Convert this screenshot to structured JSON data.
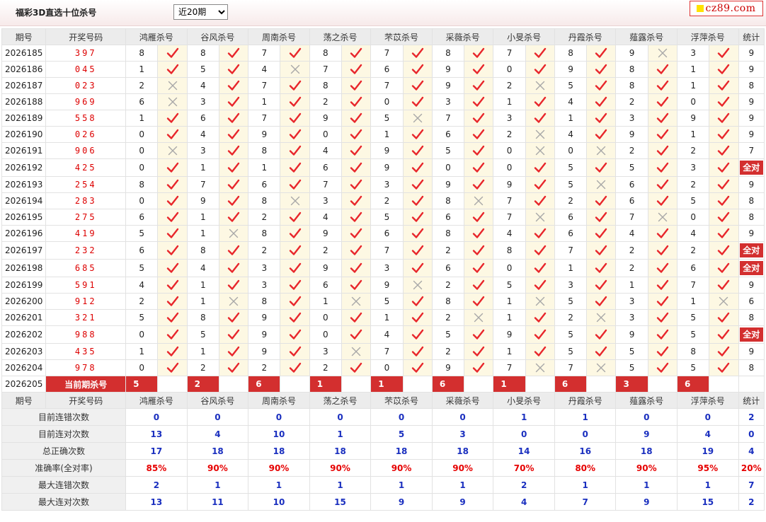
{
  "header": {
    "title": "福彩3D直选十位杀号",
    "range_options": [
      "近20期"
    ],
    "range_selected": "近20期",
    "logo_text": "cz89.com"
  },
  "columns": {
    "issue": "期号",
    "winning": "开奖号码",
    "stat": "统计",
    "experts": [
      "鸿雁杀号",
      "谷风杀号",
      "周南杀号",
      "荡之杀号",
      "芣苡杀号",
      "采薇杀号",
      "小旻杀号",
      "丹霞杀号",
      "薤露杀号",
      "浮萍杀号"
    ]
  },
  "rows": [
    {
      "issue": "2026185",
      "winning": "397",
      "kills": [
        {
          "n": "8",
          "ok": true
        },
        {
          "n": "8",
          "ok": true
        },
        {
          "n": "7",
          "ok": true
        },
        {
          "n": "8",
          "ok": true
        },
        {
          "n": "7",
          "ok": true
        },
        {
          "n": "8",
          "ok": true
        },
        {
          "n": "7",
          "ok": true
        },
        {
          "n": "8",
          "ok": true
        },
        {
          "n": "9",
          "ok": false
        },
        {
          "n": "3",
          "ok": true
        }
      ],
      "stat": "9"
    },
    {
      "issue": "2026186",
      "winning": "045",
      "kills": [
        {
          "n": "1",
          "ok": true
        },
        {
          "n": "5",
          "ok": true
        },
        {
          "n": "4",
          "ok": false
        },
        {
          "n": "7",
          "ok": true
        },
        {
          "n": "6",
          "ok": true
        },
        {
          "n": "9",
          "ok": true
        },
        {
          "n": "0",
          "ok": true
        },
        {
          "n": "9",
          "ok": true
        },
        {
          "n": "8",
          "ok": true
        },
        {
          "n": "1",
          "ok": true
        }
      ],
      "stat": "9"
    },
    {
      "issue": "2026187",
      "winning": "023",
      "kills": [
        {
          "n": "2",
          "ok": false
        },
        {
          "n": "4",
          "ok": true
        },
        {
          "n": "7",
          "ok": true
        },
        {
          "n": "8",
          "ok": true
        },
        {
          "n": "7",
          "ok": true
        },
        {
          "n": "9",
          "ok": true
        },
        {
          "n": "2",
          "ok": false
        },
        {
          "n": "5",
          "ok": true
        },
        {
          "n": "8",
          "ok": true
        },
        {
          "n": "1",
          "ok": true
        }
      ],
      "stat": "8"
    },
    {
      "issue": "2026188",
      "winning": "969",
      "kills": [
        {
          "n": "6",
          "ok": false
        },
        {
          "n": "3",
          "ok": true
        },
        {
          "n": "1",
          "ok": true
        },
        {
          "n": "2",
          "ok": true
        },
        {
          "n": "0",
          "ok": true
        },
        {
          "n": "3",
          "ok": true
        },
        {
          "n": "1",
          "ok": true
        },
        {
          "n": "4",
          "ok": true
        },
        {
          "n": "2",
          "ok": true
        },
        {
          "n": "0",
          "ok": true
        }
      ],
      "stat": "9"
    },
    {
      "issue": "2026189",
      "winning": "558",
      "kills": [
        {
          "n": "1",
          "ok": true
        },
        {
          "n": "6",
          "ok": true
        },
        {
          "n": "7",
          "ok": true
        },
        {
          "n": "9",
          "ok": true
        },
        {
          "n": "5",
          "ok": false
        },
        {
          "n": "7",
          "ok": true
        },
        {
          "n": "3",
          "ok": true
        },
        {
          "n": "1",
          "ok": true
        },
        {
          "n": "3",
          "ok": true
        },
        {
          "n": "9",
          "ok": true
        }
      ],
      "stat": "9"
    },
    {
      "issue": "2026190",
      "winning": "026",
      "kills": [
        {
          "n": "0",
          "ok": true
        },
        {
          "n": "4",
          "ok": true
        },
        {
          "n": "9",
          "ok": true
        },
        {
          "n": "0",
          "ok": true
        },
        {
          "n": "1",
          "ok": true
        },
        {
          "n": "6",
          "ok": true
        },
        {
          "n": "2",
          "ok": false
        },
        {
          "n": "4",
          "ok": true
        },
        {
          "n": "9",
          "ok": true
        },
        {
          "n": "1",
          "ok": true
        }
      ],
      "stat": "9"
    },
    {
      "issue": "2026191",
      "winning": "906",
      "kills": [
        {
          "n": "0",
          "ok": false
        },
        {
          "n": "3",
          "ok": true
        },
        {
          "n": "8",
          "ok": true
        },
        {
          "n": "4",
          "ok": true
        },
        {
          "n": "9",
          "ok": true
        },
        {
          "n": "5",
          "ok": true
        },
        {
          "n": "0",
          "ok": false
        },
        {
          "n": "0",
          "ok": false
        },
        {
          "n": "2",
          "ok": true
        },
        {
          "n": "2",
          "ok": true
        }
      ],
      "stat": "7"
    },
    {
      "issue": "2026192",
      "winning": "425",
      "kills": [
        {
          "n": "0",
          "ok": true
        },
        {
          "n": "1",
          "ok": true
        },
        {
          "n": "1",
          "ok": true
        },
        {
          "n": "6",
          "ok": true
        },
        {
          "n": "9",
          "ok": true
        },
        {
          "n": "0",
          "ok": true
        },
        {
          "n": "0",
          "ok": true
        },
        {
          "n": "5",
          "ok": true
        },
        {
          "n": "5",
          "ok": true
        },
        {
          "n": "3",
          "ok": true
        }
      ],
      "stat": "全对"
    },
    {
      "issue": "2026193",
      "winning": "254",
      "kills": [
        {
          "n": "8",
          "ok": true
        },
        {
          "n": "7",
          "ok": true
        },
        {
          "n": "6",
          "ok": true
        },
        {
          "n": "7",
          "ok": true
        },
        {
          "n": "3",
          "ok": true
        },
        {
          "n": "9",
          "ok": true
        },
        {
          "n": "9",
          "ok": true
        },
        {
          "n": "5",
          "ok": false
        },
        {
          "n": "6",
          "ok": true
        },
        {
          "n": "2",
          "ok": true
        }
      ],
      "stat": "9"
    },
    {
      "issue": "2026194",
      "winning": "283",
      "kills": [
        {
          "n": "0",
          "ok": true
        },
        {
          "n": "9",
          "ok": true
        },
        {
          "n": "8",
          "ok": false
        },
        {
          "n": "3",
          "ok": true
        },
        {
          "n": "2",
          "ok": true
        },
        {
          "n": "8",
          "ok": false
        },
        {
          "n": "7",
          "ok": true
        },
        {
          "n": "2",
          "ok": true
        },
        {
          "n": "6",
          "ok": true
        },
        {
          "n": "5",
          "ok": true
        }
      ],
      "stat": "8"
    },
    {
      "issue": "2026195",
      "winning": "275",
      "kills": [
        {
          "n": "6",
          "ok": true
        },
        {
          "n": "1",
          "ok": true
        },
        {
          "n": "2",
          "ok": true
        },
        {
          "n": "4",
          "ok": true
        },
        {
          "n": "5",
          "ok": true
        },
        {
          "n": "6",
          "ok": true
        },
        {
          "n": "7",
          "ok": false
        },
        {
          "n": "6",
          "ok": true
        },
        {
          "n": "7",
          "ok": false
        },
        {
          "n": "0",
          "ok": true
        }
      ],
      "stat": "8"
    },
    {
      "issue": "2026196",
      "winning": "419",
      "kills": [
        {
          "n": "5",
          "ok": true
        },
        {
          "n": "1",
          "ok": false
        },
        {
          "n": "8",
          "ok": true
        },
        {
          "n": "9",
          "ok": true
        },
        {
          "n": "6",
          "ok": true
        },
        {
          "n": "8",
          "ok": true
        },
        {
          "n": "4",
          "ok": true
        },
        {
          "n": "6",
          "ok": true
        },
        {
          "n": "4",
          "ok": true
        },
        {
          "n": "4",
          "ok": true
        }
      ],
      "stat": "9"
    },
    {
      "issue": "2026197",
      "winning": "232",
      "kills": [
        {
          "n": "6",
          "ok": true
        },
        {
          "n": "8",
          "ok": true
        },
        {
          "n": "2",
          "ok": true
        },
        {
          "n": "2",
          "ok": true
        },
        {
          "n": "7",
          "ok": true
        },
        {
          "n": "2",
          "ok": true
        },
        {
          "n": "8",
          "ok": true
        },
        {
          "n": "7",
          "ok": true
        },
        {
          "n": "2",
          "ok": true
        },
        {
          "n": "2",
          "ok": true
        }
      ],
      "stat": "全对"
    },
    {
      "issue": "2026198",
      "winning": "685",
      "kills": [
        {
          "n": "5",
          "ok": true
        },
        {
          "n": "4",
          "ok": true
        },
        {
          "n": "3",
          "ok": true
        },
        {
          "n": "9",
          "ok": true
        },
        {
          "n": "3",
          "ok": true
        },
        {
          "n": "6",
          "ok": true
        },
        {
          "n": "0",
          "ok": true
        },
        {
          "n": "1",
          "ok": true
        },
        {
          "n": "2",
          "ok": true
        },
        {
          "n": "6",
          "ok": true
        }
      ],
      "stat": "全对"
    },
    {
      "issue": "2026199",
      "winning": "591",
      "kills": [
        {
          "n": "4",
          "ok": true
        },
        {
          "n": "1",
          "ok": true
        },
        {
          "n": "3",
          "ok": true
        },
        {
          "n": "6",
          "ok": true
        },
        {
          "n": "9",
          "ok": false
        },
        {
          "n": "2",
          "ok": true
        },
        {
          "n": "5",
          "ok": true
        },
        {
          "n": "3",
          "ok": true
        },
        {
          "n": "1",
          "ok": true
        },
        {
          "n": "7",
          "ok": true
        }
      ],
      "stat": "9"
    },
    {
      "issue": "2026200",
      "winning": "912",
      "kills": [
        {
          "n": "2",
          "ok": true
        },
        {
          "n": "1",
          "ok": false
        },
        {
          "n": "8",
          "ok": true
        },
        {
          "n": "1",
          "ok": false
        },
        {
          "n": "5",
          "ok": true
        },
        {
          "n": "8",
          "ok": true
        },
        {
          "n": "1",
          "ok": false
        },
        {
          "n": "5",
          "ok": true
        },
        {
          "n": "3",
          "ok": true
        },
        {
          "n": "1",
          "ok": false
        }
      ],
      "stat": "6"
    },
    {
      "issue": "2026201",
      "winning": "321",
      "kills": [
        {
          "n": "5",
          "ok": true
        },
        {
          "n": "8",
          "ok": true
        },
        {
          "n": "9",
          "ok": true
        },
        {
          "n": "0",
          "ok": true
        },
        {
          "n": "1",
          "ok": true
        },
        {
          "n": "2",
          "ok": false
        },
        {
          "n": "1",
          "ok": true
        },
        {
          "n": "2",
          "ok": false
        },
        {
          "n": "3",
          "ok": true
        },
        {
          "n": "5",
          "ok": true
        }
      ],
      "stat": "8"
    },
    {
      "issue": "2026202",
      "winning": "988",
      "kills": [
        {
          "n": "0",
          "ok": true
        },
        {
          "n": "5",
          "ok": true
        },
        {
          "n": "9",
          "ok": true
        },
        {
          "n": "0",
          "ok": true
        },
        {
          "n": "4",
          "ok": true
        },
        {
          "n": "5",
          "ok": true
        },
        {
          "n": "9",
          "ok": true
        },
        {
          "n": "5",
          "ok": true
        },
        {
          "n": "9",
          "ok": true
        },
        {
          "n": "5",
          "ok": true
        }
      ],
      "stat": "全对"
    },
    {
      "issue": "2026203",
      "winning": "435",
      "kills": [
        {
          "n": "1",
          "ok": true
        },
        {
          "n": "1",
          "ok": true
        },
        {
          "n": "9",
          "ok": true
        },
        {
          "n": "3",
          "ok": false
        },
        {
          "n": "7",
          "ok": true
        },
        {
          "n": "2",
          "ok": true
        },
        {
          "n": "1",
          "ok": true
        },
        {
          "n": "5",
          "ok": true
        },
        {
          "n": "5",
          "ok": true
        },
        {
          "n": "8",
          "ok": true
        }
      ],
      "stat": "9"
    },
    {
      "issue": "2026204",
      "winning": "978",
      "kills": [
        {
          "n": "0",
          "ok": true
        },
        {
          "n": "2",
          "ok": true
        },
        {
          "n": "2",
          "ok": true
        },
        {
          "n": "2",
          "ok": true
        },
        {
          "n": "0",
          "ok": true
        },
        {
          "n": "9",
          "ok": true
        },
        {
          "n": "7",
          "ok": false
        },
        {
          "n": "7",
          "ok": false
        },
        {
          "n": "5",
          "ok": true
        },
        {
          "n": "5",
          "ok": true
        }
      ],
      "stat": "8"
    }
  ],
  "current": {
    "issue": "2026205",
    "label": "当前期杀号",
    "kills": [
      "5",
      "2",
      "6",
      "1",
      "1",
      "6",
      "1",
      "6",
      "3",
      "6"
    ]
  },
  "summary": [
    {
      "label": "目前连错次数",
      "values": [
        "0",
        "0",
        "0",
        "0",
        "0",
        "0",
        "1",
        "1",
        "0",
        "0"
      ],
      "stat": "2",
      "rate": false
    },
    {
      "label": "目前连对次数",
      "values": [
        "13",
        "4",
        "10",
        "1",
        "5",
        "3",
        "0",
        "0",
        "9",
        "4"
      ],
      "stat": "0",
      "rate": false
    },
    {
      "label": "总正确次数",
      "values": [
        "17",
        "18",
        "18",
        "18",
        "18",
        "18",
        "14",
        "16",
        "18",
        "19"
      ],
      "stat": "4",
      "rate": false
    },
    {
      "label": "准确率(全对率)",
      "values": [
        "85%",
        "90%",
        "90%",
        "90%",
        "90%",
        "90%",
        "70%",
        "80%",
        "90%",
        "95%"
      ],
      "stat": "20%",
      "rate": true
    },
    {
      "label": "最大连错次数",
      "values": [
        "2",
        "1",
        "1",
        "1",
        "1",
        "1",
        "2",
        "1",
        "1",
        "1"
      ],
      "stat": "7",
      "rate": false
    },
    {
      "label": "最大连对次数",
      "values": [
        "13",
        "11",
        "10",
        "15",
        "9",
        "9",
        "4",
        "7",
        "9",
        "15"
      ],
      "stat": "2",
      "rate": false
    }
  ],
  "icons": {
    "correct": "check-icon",
    "wrong": "cross-icon"
  },
  "colors": {
    "accent": "#d32f2f",
    "winning": "#dd0000",
    "summary_value": "#1a2fbf",
    "rate": "#e60000",
    "mark_bg": "#fdf8e3"
  }
}
